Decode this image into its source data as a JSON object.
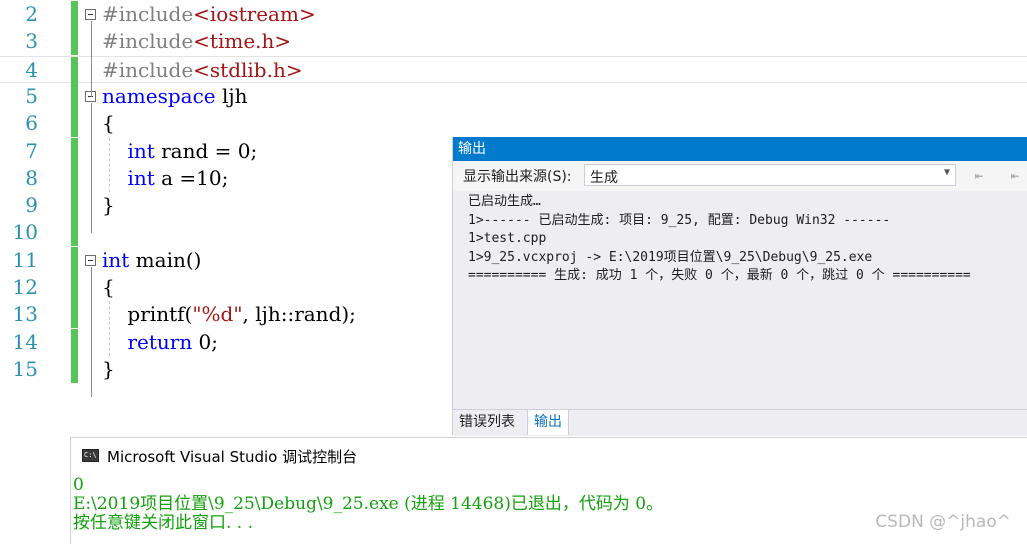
{
  "editor": {
    "lines": [
      {
        "num": "2",
        "parts": [
          {
            "cls": "pp",
            "text": "#include"
          },
          {
            "cls": "inc",
            "text": "<iostream>"
          }
        ]
      },
      {
        "num": "3",
        "parts": [
          {
            "cls": "pp",
            "text": "#include"
          },
          {
            "cls": "inc",
            "text": "<time.h>"
          }
        ]
      },
      {
        "num": "4",
        "parts": [
          {
            "cls": "pp",
            "text": "#include"
          },
          {
            "cls": "inc",
            "text": "<stdlib.h>"
          }
        ]
      },
      {
        "num": "5",
        "parts": [
          {
            "cls": "kw",
            "text": "namespace"
          },
          {
            "cls": "",
            "text": " ljh"
          }
        ]
      },
      {
        "num": "6",
        "parts": [
          {
            "cls": "",
            "text": "{"
          }
        ]
      },
      {
        "num": "7",
        "parts": [
          {
            "cls": "",
            "text": "    "
          },
          {
            "cls": "kw",
            "text": "int"
          },
          {
            "cls": "",
            "text": " rand = 0;"
          }
        ]
      },
      {
        "num": "8",
        "parts": [
          {
            "cls": "",
            "text": "    "
          },
          {
            "cls": "kw",
            "text": "int"
          },
          {
            "cls": "",
            "text": " a =10;"
          }
        ]
      },
      {
        "num": "9",
        "parts": [
          {
            "cls": "",
            "text": "}"
          }
        ]
      },
      {
        "num": "10",
        "parts": []
      },
      {
        "num": "11",
        "parts": [
          {
            "cls": "kw",
            "text": "int"
          },
          {
            "cls": "",
            "text": " main()"
          }
        ]
      },
      {
        "num": "12",
        "parts": [
          {
            "cls": "",
            "text": "{"
          }
        ]
      },
      {
        "num": "13",
        "parts": [
          {
            "cls": "",
            "text": "    printf("
          },
          {
            "cls": "str",
            "text": "\"%d\""
          },
          {
            "cls": "",
            "text": ", ljh::rand);"
          }
        ]
      },
      {
        "num": "14",
        "parts": [
          {
            "cls": "",
            "text": "    "
          },
          {
            "cls": "kw",
            "text": "return"
          },
          {
            "cls": "",
            "text": " 0;"
          }
        ]
      },
      {
        "num": "15",
        "parts": [
          {
            "cls": "",
            "text": "}"
          }
        ]
      }
    ]
  },
  "output_panel": {
    "title": "输出",
    "source_label": "显示输出来源(S):",
    "source_value": "生成",
    "lines": [
      "已启动生成…",
      "1>------ 已启动生成: 项目: 9_25, 配置: Debug Win32 ------",
      "1>test.cpp",
      "1>9_25.vcxproj -> E:\\2019项目位置\\9_25\\Debug\\9_25.exe",
      "========== 生成: 成功 1 个，失败 0 个，最新 0 个，跳过 0 个 =========="
    ],
    "tabs": {
      "errors": "错误列表",
      "output": "输出"
    }
  },
  "console": {
    "title": "Microsoft Visual Studio 调试控制台",
    "icon_text": "C:\\",
    "lines": [
      "0",
      "E:\\2019项目位置\\9_25\\Debug\\9_25.exe (进程 14468)已退出，代码为 0。",
      "按任意键关闭此窗口. . ."
    ]
  },
  "watermark": "CSDN @^jhao^",
  "colors": {
    "accent": "#007acc",
    "keyword": "#0000ff",
    "string": "#a31515",
    "console_text": "#13a10e",
    "line_number": "#2b91af"
  }
}
